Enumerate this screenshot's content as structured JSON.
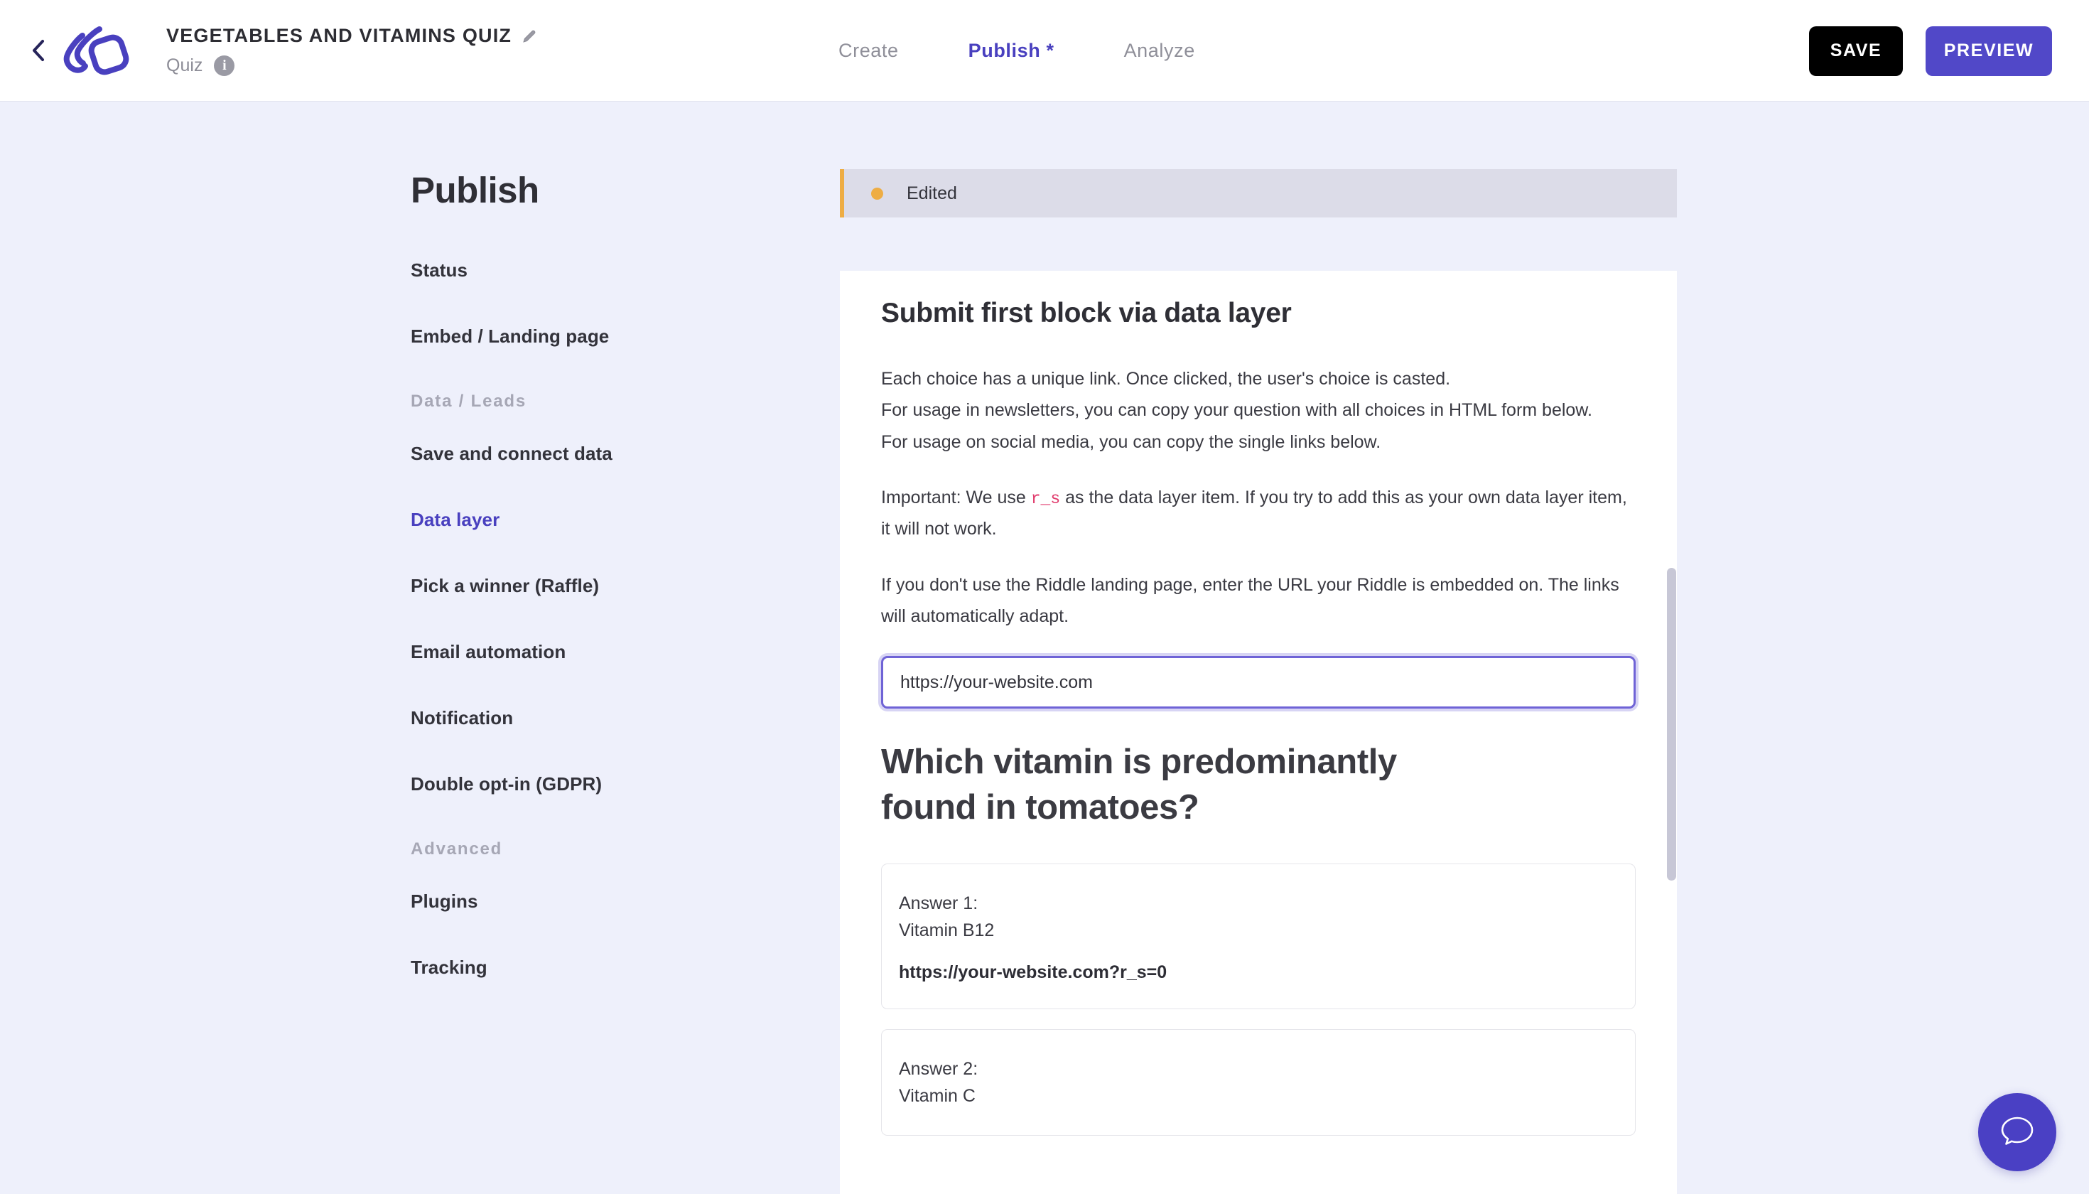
{
  "topbar": {
    "back_icon": "chevron-left-icon",
    "logo_icon": "riddle-logo-icon",
    "quiz_title": "VEGETABLES AND VITAMINS QUIZ",
    "edit_title_icon": "pencil-icon",
    "subtitle": "Quiz",
    "info_icon_label": "i",
    "tabs": [
      {
        "label": "Create",
        "active": false
      },
      {
        "label": "Publish *",
        "active": true
      },
      {
        "label": "Analyze",
        "active": false
      }
    ],
    "save_label": "SAVE",
    "preview_label": "PREVIEW"
  },
  "sidebar": {
    "title": "Publish",
    "items": [
      {
        "label": "Status",
        "type": "item",
        "active": false
      },
      {
        "label": "Embed / Landing page",
        "type": "item",
        "active": false
      },
      {
        "label": "Data / Leads",
        "type": "group"
      },
      {
        "label": "Save and connect data",
        "type": "item",
        "active": false
      },
      {
        "label": "Data layer",
        "type": "item",
        "active": true
      },
      {
        "label": "Pick a winner (Raffle)",
        "type": "item",
        "active": false
      },
      {
        "label": "Email automation",
        "type": "item",
        "active": false
      },
      {
        "label": "Notification",
        "type": "item",
        "active": false
      },
      {
        "label": "Double opt-in (GDPR)",
        "type": "item",
        "active": false
      },
      {
        "label": "Advanced",
        "type": "group"
      },
      {
        "label": "Plugins",
        "type": "item",
        "active": false
      },
      {
        "label": "Tracking",
        "type": "item",
        "active": false
      }
    ]
  },
  "status_bar": {
    "label": "Edited",
    "dot_color": "#eead44"
  },
  "content": {
    "heading": "Submit first block via data layer",
    "paragraph_1_line_1": "Each choice has a unique link. Once clicked, the user's choice is casted.",
    "paragraph_1_line_2": "For usage in newsletters, you can copy your question with all choices in HTML form below.",
    "paragraph_1_line_3": "For usage on social media, you can copy the single links below.",
    "paragraph_2_prefix": "Important: We use ",
    "paragraph_2_code": "r_s",
    "paragraph_2_suffix": " as the data layer item. If you try to add this as your own data layer item, it will not work.",
    "paragraph_3": "If you don't use the Riddle landing page, enter the URL your Riddle is embedded on. The links will automatically adapt.",
    "url_input_value": "https://your-website.com",
    "url_input_placeholder": "https://your-website.com",
    "question": "Which vitamin is predominantly found in tomatoes?",
    "answers": [
      {
        "number_label": "Answer 1:",
        "text": "Vitamin B12",
        "link": "https://your-website.com?r_s=0"
      },
      {
        "number_label": "Answer 2:",
        "text": "Vitamin C",
        "link": ""
      }
    ]
  },
  "chat": {
    "icon": "chat-bubble-icon"
  },
  "colors": {
    "accent": "#4940bf",
    "preview_button": "#5148c8",
    "page_background": "#eef0fb",
    "status_accent": "#eead44",
    "code_pink": "#e0396b"
  }
}
